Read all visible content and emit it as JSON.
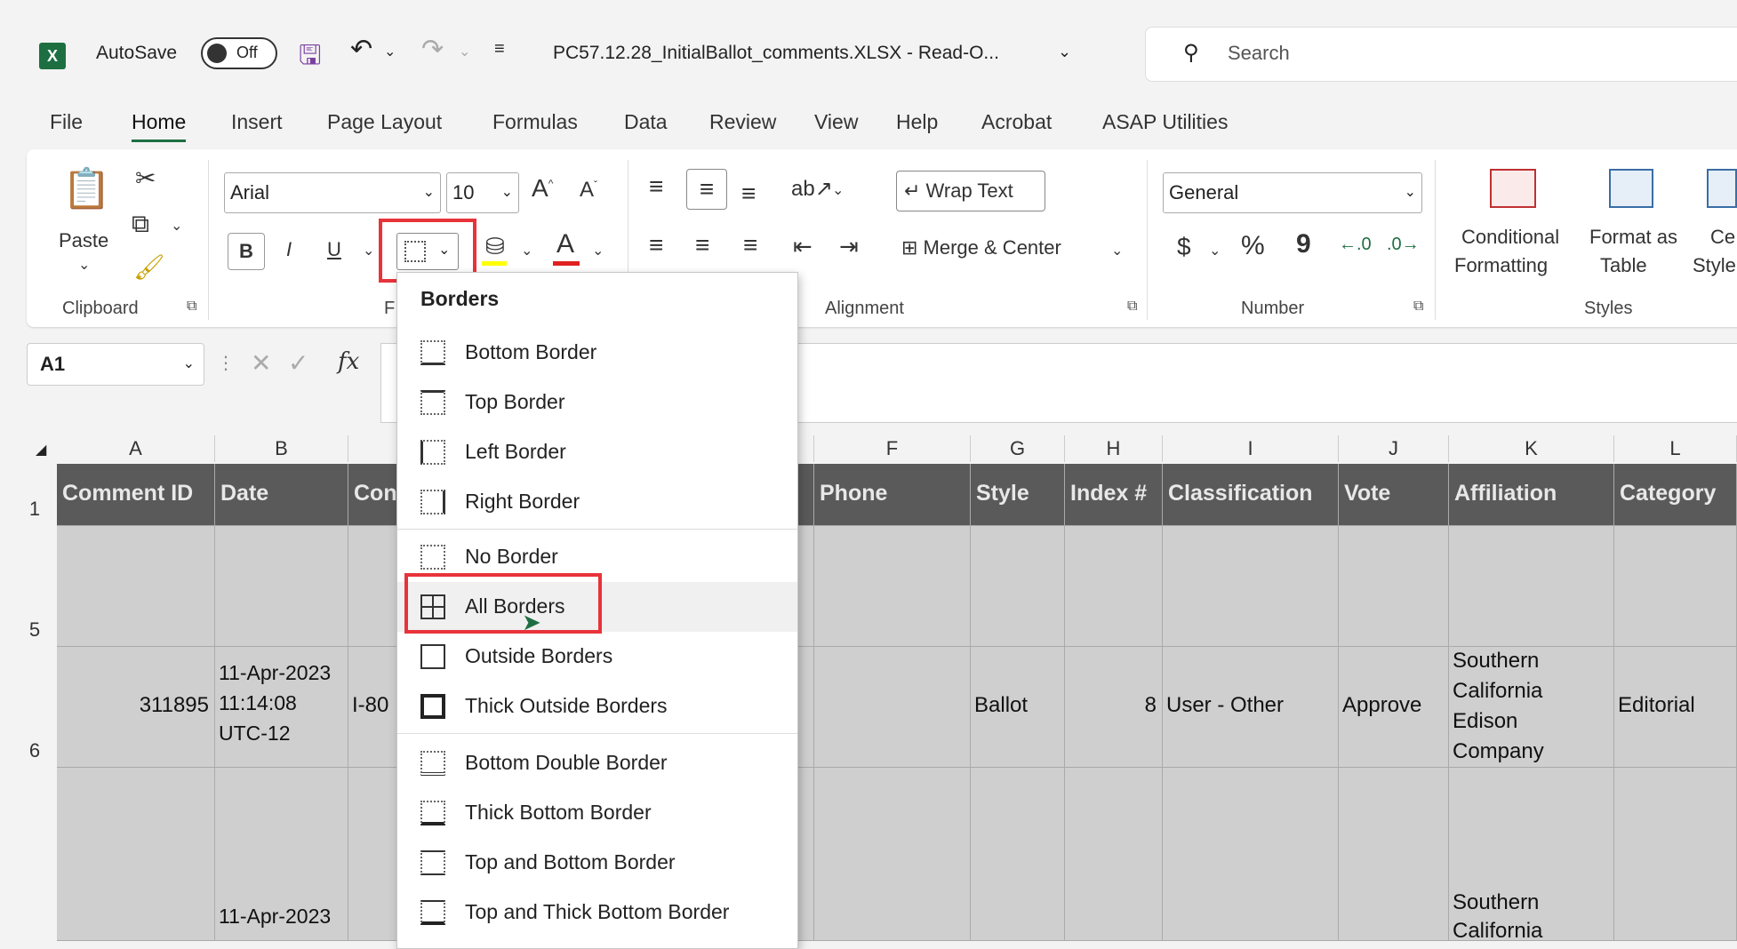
{
  "titlebar": {
    "autosave": "AutoSave",
    "toggle": "Off",
    "filename": "PC57.12.28_InitialBallot_comments.XLSX  -  Read-O...",
    "search_placeholder": "Search"
  },
  "tabs": [
    "File",
    "Home",
    "Insert",
    "Page Layout",
    "Formulas",
    "Data",
    "Review",
    "View",
    "Help",
    "Acrobat",
    "ASAP Utilities"
  ],
  "ribbon": {
    "paste": "Paste",
    "clipboard": "Clipboard",
    "font_label_partial": "F",
    "font_name": "Arial",
    "font_size": "10",
    "bold": "B",
    "italic": "I",
    "underline": "U",
    "wrap_text": "Wrap Text",
    "merge_center": "Merge & Center",
    "alignment": "Alignment",
    "number_format": "General",
    "currency": "$",
    "percent": "%",
    "comma": "9",
    "number": "Number",
    "conditional": "Conditional",
    "formatting": "Formatting",
    "format_as": "Format as",
    "table": "Table",
    "ce": "Ce",
    "style": "Style",
    "styles": "Styles"
  },
  "formula_bar": {
    "namebox": "A1",
    "fx": "fx"
  },
  "columns": [
    "A",
    "B",
    "",
    "F",
    "G",
    "H",
    "I",
    "J",
    "K",
    "L"
  ],
  "rows": [
    "1",
    "5",
    "6"
  ],
  "header_cells": [
    "Comment ID",
    "Date",
    "Con",
    "Phone",
    "Style",
    "Index #",
    "Classification",
    "Vote",
    "Affiliation",
    "Category"
  ],
  "row6": {
    "id": "311895",
    "date1": "11-Apr-2023",
    "date2": "11:14:08",
    "date3": "UTC-12",
    "com": "I-80",
    "style": "Ballot",
    "index": "8",
    "classification": "User - Other",
    "vote": "Approve",
    "aff1": "Southern",
    "aff2": "California",
    "aff3": "Edison",
    "aff4": "Company",
    "category": "Editorial"
  },
  "row7": {
    "date1": "11-Apr-2023",
    "aff1": "Southern",
    "aff2": "California"
  },
  "borders_menu": {
    "heading": "Borders",
    "items": [
      "Bottom Border",
      "Top Border",
      "Left Border",
      "Right Border",
      "No Border",
      "All Borders",
      "Outside Borders",
      "Thick Outside Borders",
      "Bottom Double Border",
      "Thick Bottom Border",
      "Top and Bottom Border",
      "Top and Thick Bottom Border"
    ]
  }
}
